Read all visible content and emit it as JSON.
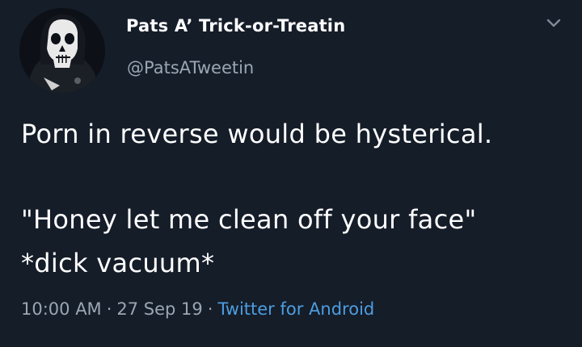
{
  "author": {
    "display_name": "Pats A’ Trick-or-Treatin",
    "handle": "@PatsATweetin",
    "avatar_icon": "skull-avatar"
  },
  "menu_icon": "chevron-down-icon",
  "body": {
    "line1": "Porn in reverse would be hysterical.",
    "line2": "\"Honey let me clean off your face\"",
    "line3": "*dick vacuum*"
  },
  "meta": {
    "time": "10:00 AM",
    "date": "27 Sep 19",
    "source": "Twitter for Android",
    "separator": "·"
  },
  "colors": {
    "background": "#151d29",
    "text": "#ffffff",
    "muted": "#9aa6b2",
    "link": "#4d9de0"
  }
}
